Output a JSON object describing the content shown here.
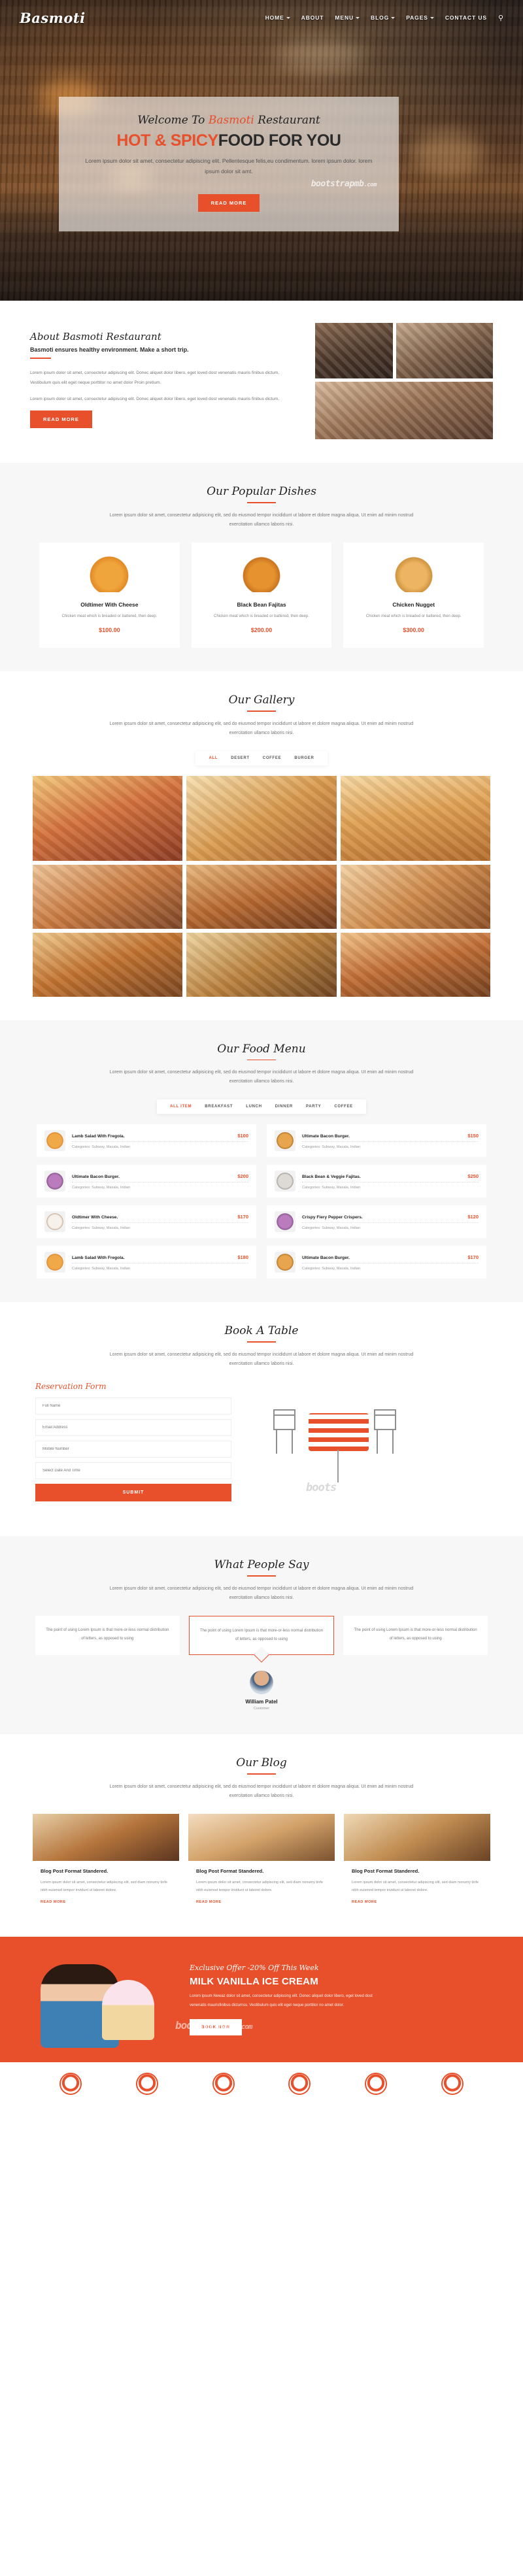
{
  "nav": {
    "logo": "Basmoti",
    "items": [
      {
        "label": "HOME",
        "caret": true
      },
      {
        "label": "ABOUT",
        "caret": false
      },
      {
        "label": "MENU",
        "caret": true
      },
      {
        "label": "BLOG",
        "caret": true
      },
      {
        "label": "PAGES",
        "caret": true
      },
      {
        "label": "CONTACT US",
        "caret": false
      }
    ],
    "search_icon": "search-icon"
  },
  "hero": {
    "welcome_pre": "Welcome To ",
    "welcome_brand": "Basmoti",
    "welcome_post": " Restaurant",
    "headline_accent": "HOT & SPICY",
    "headline_rest": "FOOD FOR YOU",
    "paragraph": "Lorem ipsum dolor sit amet, consectetur adipiscing elit. Pellentesque felis,eu condimentum. lorem ipsum dolor. lorem ipsum dolor sit amt.",
    "watermark": "bootstrapmb",
    "watermark_tld": ".com",
    "button": "READ MORE"
  },
  "about": {
    "title": "About Basmoti Restaurant",
    "subtitle": "Basmoti ensures healthy environment. Make a short trip.",
    "p1": "Lorem ipsum dolor sit amet, consectetur adipiscing elit. Donec aliquet dolor libero, eget loved dost venenatis mauris finibus dictum. Vestibulum quis elit eget neque porttitor no amet dolor Proin pretium.",
    "p2": "Lorem ipsum dolor sit amet, consectetur adipiscing elit. Donec aliquet dolor libero, eget loved dost venenatis mauris finibus dictum.",
    "button": "READ MORE"
  },
  "dishes_section": {
    "title": "Our Popular Dishes",
    "subtitle": "Lorem ipsum dolor sit amet, consectetur adipisicing elit, sed do eiusmod tempor incididunt ut labore et dolore magna aliqua. Ut enim ad minim nostrud exercitation ullamco laboris nisi.",
    "items": [
      {
        "name": "Oldtimer With Cheese",
        "desc": "Chicken meat which is breaded or battered, then deep.",
        "price": "$100.00"
      },
      {
        "name": "Black Bean Fajitas",
        "desc": "Chicken meat which is breaded or battered, then deep.",
        "price": "$200.00"
      },
      {
        "name": "Chicken Nugget",
        "desc": "Chicken meat which is breaded or battered, then deep.",
        "price": "$300.00"
      }
    ]
  },
  "gallery": {
    "title": "Our Gallery",
    "subtitle": "Lorem ipsum dolor sit amet, consectetur adipisicing elit, sed do eiusmod tempor incididunt ut labore et dolore magna aliqua. Ut enim ad minim nostrud exercitation ullamco laboris nisi.",
    "filters": [
      "ALL",
      "DESERT",
      "COFFEE",
      "BURGER"
    ],
    "active_filter": "ALL"
  },
  "food_menu": {
    "title": "Our Food Menu",
    "subtitle": "Lorem ipsum dolor sit amet, consectetur adipisicing elit, sed do eiusmod tempor incididunt ut labore et dolore magna aliqua. Ut enim ad minim nostrud exercitation ullamco laboris nisi.",
    "tabs": [
      "ALL ITEM",
      "BREAKFAST",
      "LUNCH",
      "DINNER",
      "PARTY",
      "COFFEE"
    ],
    "active_tab": "ALL ITEM",
    "items": [
      {
        "name": "Lamb Salad With Fregola.",
        "categories": "Categories: Subway, Masala, Indian",
        "price": "$100"
      },
      {
        "name": "Ultimate Bacon Burger.",
        "categories": "Categories: Subway, Masala, Indian",
        "price": "$150"
      },
      {
        "name": "Ultimate Bacon Burger.",
        "categories": "Categories: Subway, Masala, Indian",
        "price": "$200"
      },
      {
        "name": "Black Bean & Veggie Fajitas.",
        "categories": "Categories: Subway, Masala, Indian",
        "price": "$250"
      },
      {
        "name": "Oldtimer With Cheese.",
        "categories": "Categories: Subway, Masala, Indian",
        "price": "$170"
      },
      {
        "name": "Crispy Fiery Pepper Crispers.",
        "categories": "Categories: Subway, Masala, Indian",
        "price": "$120"
      },
      {
        "name": "Lamb Salad With Fregola.",
        "categories": "Categories: Subway, Masala, Indian",
        "price": "$180"
      },
      {
        "name": "Ultimate Bacon Burger.",
        "categories": "Categories: Subway, Masala, Indian",
        "price": "$170"
      }
    ]
  },
  "booking": {
    "title": "Book A Table",
    "subtitle": "Lorem ipsum dolor sit amet, consectetur adipisicing elit, sed do eiusmod tempor incididunt ut labore et dolore magna aliqua. Ut enim ad minim nostrud exercitation ullamco laboris nisi.",
    "form_title": "Reservation Form",
    "fields": [
      {
        "placeholder": "Full Name",
        "value": ""
      },
      {
        "placeholder": "Email Address",
        "value": ""
      },
      {
        "placeholder": "Mobile Number",
        "value": ""
      },
      {
        "placeholder": "Select Date And Time",
        "value": ""
      }
    ],
    "submit": "SUBMIT",
    "art_watermark": "boots"
  },
  "testimonials": {
    "title": "What People Say",
    "subtitle": "Lorem ipsum dolor sit amet, consectetur adipisicing elit, sed do eiusmod tempor incididunt ut labore et dolore magna aliqua. Ut enim ad minim nostrud exercitation ullamco laboris nisi.",
    "quotes": [
      "The point of using Lorem Ipsum is that more-or-less normal distribution of letters, as opposed to using",
      "The point of using Lorem Ipsum is that more-or-less normal distribution of letters, as opposed to using",
      "The point of using Lorem Ipsum is that more-or-less normal distribution of letters, as opposed to using"
    ],
    "active_index": 1,
    "person_name": "William Patel",
    "person_role": "Customer"
  },
  "blog": {
    "title": "Our Blog",
    "subtitle": "Lorem ipsum dolor sit amet, consectetur adipisicing elit, sed do eiusmod tempor incididunt ut labore et dolore magna aliqua. Ut enim ad minim nostrud exercitation ullamco laboris nisi.",
    "posts": [
      {
        "title": "Blog Post Format Standered.",
        "excerpt": "Lorem ipsum dolor sit amet, consectetur adipiscing elit, sed diam nonumy tinfe nibh euismod tempor invidunt ut laboret dolore.",
        "more": "READ MORE"
      },
      {
        "title": "Blog Post Format Standered.",
        "excerpt": "Lorem ipsum dolor sit amet, consectetur adipiscing elit, sed diam nonumy tinfe nibh euismod tempor invidunt ut laboret dolore.",
        "more": "READ MORE"
      },
      {
        "title": "Blog Post Format Standered.",
        "excerpt": "Lorem ipsum dolor sit amet, consectetur adipiscing elit, sed diam nonumy tinfe nibh euismod tempor invidunt ut laboret dolore.",
        "more": "READ MORE"
      }
    ]
  },
  "cta": {
    "kicker": "Exclusive Offer -20% Off This Week",
    "headline": "MILK VANILLA ICE CREAM",
    "paragraph": "Lorem ipsum Newaz dolor sit amet, consectetur adipiscing elit. Donec aliquet dolor libero, eget loved dost venenatis maurisfinibus dictumss. Vestibulum quis elit eget neque porttitor no amet dolor.",
    "button": "BOOK NOW",
    "watermark": "bootstrapmb",
    "watermark_tld": ".com"
  },
  "colors": {
    "accent": "#e8502b",
    "dark": "#222222",
    "muted": "#888888",
    "gray_bg": "#f7f7f7"
  }
}
